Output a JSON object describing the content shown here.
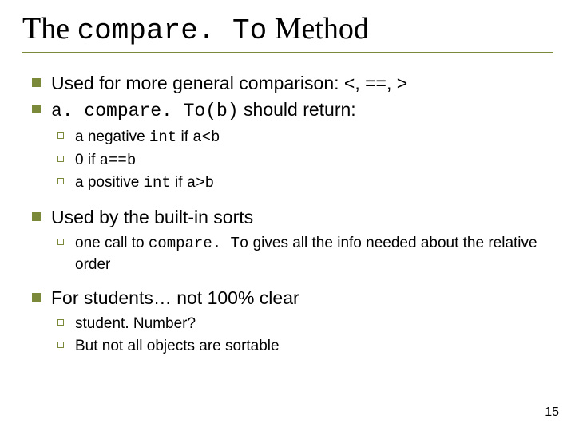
{
  "title": {
    "pre": "The ",
    "mono": "compare. To",
    "post": " Method"
  },
  "items": [
    {
      "segs": [
        {
          "t": "Used for more general comparison: <, ==, >",
          "m": false
        }
      ],
      "sub": null
    },
    {
      "segs": [
        {
          "t": "a. compare. To(b)",
          "m": true
        },
        {
          "t": " should return:",
          "m": false
        }
      ],
      "sub": [
        [
          {
            "t": "a negative ",
            "m": false
          },
          {
            "t": "int",
            "m": true
          },
          {
            "t": " if ",
            "m": false
          },
          {
            "t": "a<b",
            "m": true
          }
        ],
        [
          {
            "t": "0 if ",
            "m": false
          },
          {
            "t": "a==b",
            "m": true
          }
        ],
        [
          {
            "t": "a positive ",
            "m": false
          },
          {
            "t": "int",
            "m": true
          },
          {
            "t": " if ",
            "m": false
          },
          {
            "t": "a>b",
            "m": true
          }
        ]
      ]
    },
    {
      "segs": [
        {
          "t": "Used by the built-in sorts",
          "m": false
        }
      ],
      "sub": [
        [
          {
            "t": "one call to ",
            "m": false
          },
          {
            "t": "compare. To",
            "m": true
          },
          {
            "t": " gives all the info needed about the relative order",
            "m": false
          }
        ]
      ]
    },
    {
      "segs": [
        {
          "t": "For students… not 100% clear",
          "m": false
        }
      ],
      "sub": [
        [
          {
            "t": "student. Number?",
            "m": false
          }
        ],
        [
          {
            "t": "But not all objects are sortable",
            "m": false
          }
        ]
      ]
    }
  ],
  "page": "15"
}
